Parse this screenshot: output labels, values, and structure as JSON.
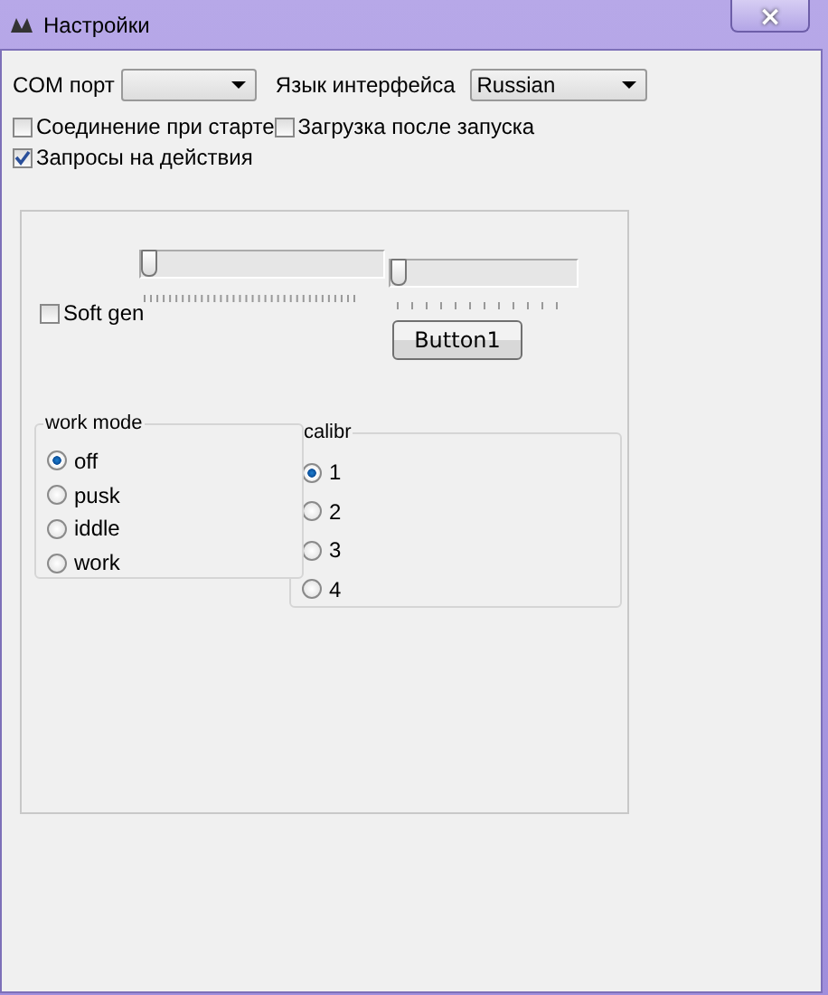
{
  "window": {
    "title": "Настройки",
    "close": "×"
  },
  "com_port": {
    "label": "COM порт"
  },
  "language": {
    "label": "Язык интерфейса",
    "value": "Russian"
  },
  "checks": [
    {
      "label": "Соединение при старте",
      "checked": false
    },
    {
      "label": "Загрузка после запуска",
      "checked": false
    },
    {
      "label": "Запросы на действия",
      "checked": true
    }
  ],
  "panel": {
    "sliders": [
      {
        "level": 0
      },
      {
        "level": 0
      }
    ],
    "soft_gen": {
      "label": "Soft gen",
      "checked": false
    },
    "button": "Button1",
    "groups": [
      {
        "title": "work mode",
        "options": [
          {
            "label": "off",
            "selected": true
          },
          {
            "label": "pusk",
            "selected": false
          },
          {
            "label": "iddle",
            "selected": false
          },
          {
            "label": "work",
            "selected": false
          }
        ]
      },
      {
        "title": "calibr",
        "options": [
          {
            "label": "1",
            "selected": true
          },
          {
            "label": "2",
            "selected": false
          },
          {
            "label": "3",
            "selected": false
          },
          {
            "label": "4",
            "selected": false
          }
        ]
      }
    ]
  }
}
